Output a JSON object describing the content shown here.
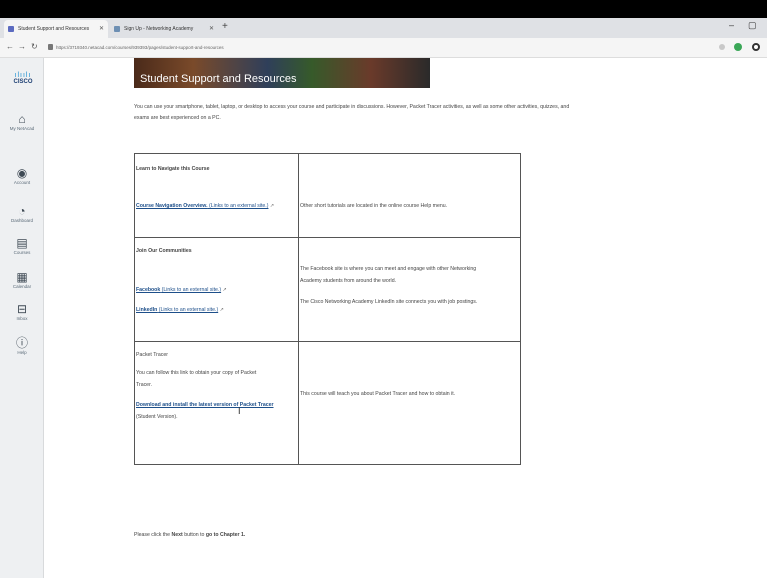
{
  "browser": {
    "tabs": [
      {
        "label": "Student Support and Resources"
      },
      {
        "label": "Sign Up - Networking Academy"
      }
    ],
    "url": "https://3719340.netacad.com/courses/939393/pages/student-support-and-resources",
    "window_controls": {
      "minimize": "–",
      "maximize": "▢"
    }
  },
  "sidebar": {
    "logo_bars": "ılıılı",
    "logo_word": "CISCO",
    "items": [
      {
        "label": "My NetAcad",
        "icon": "home-icon"
      },
      {
        "label": "Account",
        "icon": "user-icon"
      },
      {
        "label": "Dashboard",
        "icon": "dashboard-icon"
      },
      {
        "label": "Courses",
        "icon": "book-icon"
      },
      {
        "label": "Calendar",
        "icon": "calendar-icon"
      },
      {
        "label": "Inbox",
        "icon": "inbox-icon"
      },
      {
        "label": "Help",
        "icon": "help-icon"
      }
    ]
  },
  "page": {
    "banner_title": "Student Support and Resources",
    "intro": "You can use your smartphone, tablet, laptop, or desktop to access your course and participate in discussions. However, Packet Tracer activities, as well as some other activities, quizzes, and exams are best experienced on a PC.",
    "sections": {
      "navigate": {
        "heading": "Learn to Navigate this Course",
        "link": "Course Navigation Overview.",
        "link_suffix": "(Links to an external site.)",
        "desc": "Other short tutorials are located in the online course Help menu."
      },
      "communities": {
        "heading": "Join Our Communities",
        "facebook": "Facebook",
        "facebook_suffix": "(Links to an external site.)",
        "linkedin": "LinkedIn",
        "linkedin_suffix": "(Links to an external site.)",
        "desc1a": "The Facebook site is where you can meet and engage with other Networking",
        "desc1b": "Academy students from around the world.",
        "desc2": "The Cisco Networking Academy LinkedIn site connects you with job postings."
      },
      "packet_tracer": {
        "heading": "Packet Tracer",
        "line1": "You can follow this link to obtain your copy of Packet",
        "line2": "Tracer.",
        "link": "Download and install the latest version of Packet Tracer",
        "line3": "(Student Version).",
        "desc": "This course will teach you about Packet Tracer and how to obtain it."
      }
    },
    "footer_pre": "Please click the",
    "footer_next": "Next",
    "footer_mid": "button to",
    "footer_goto": "go to Chapter 1."
  }
}
